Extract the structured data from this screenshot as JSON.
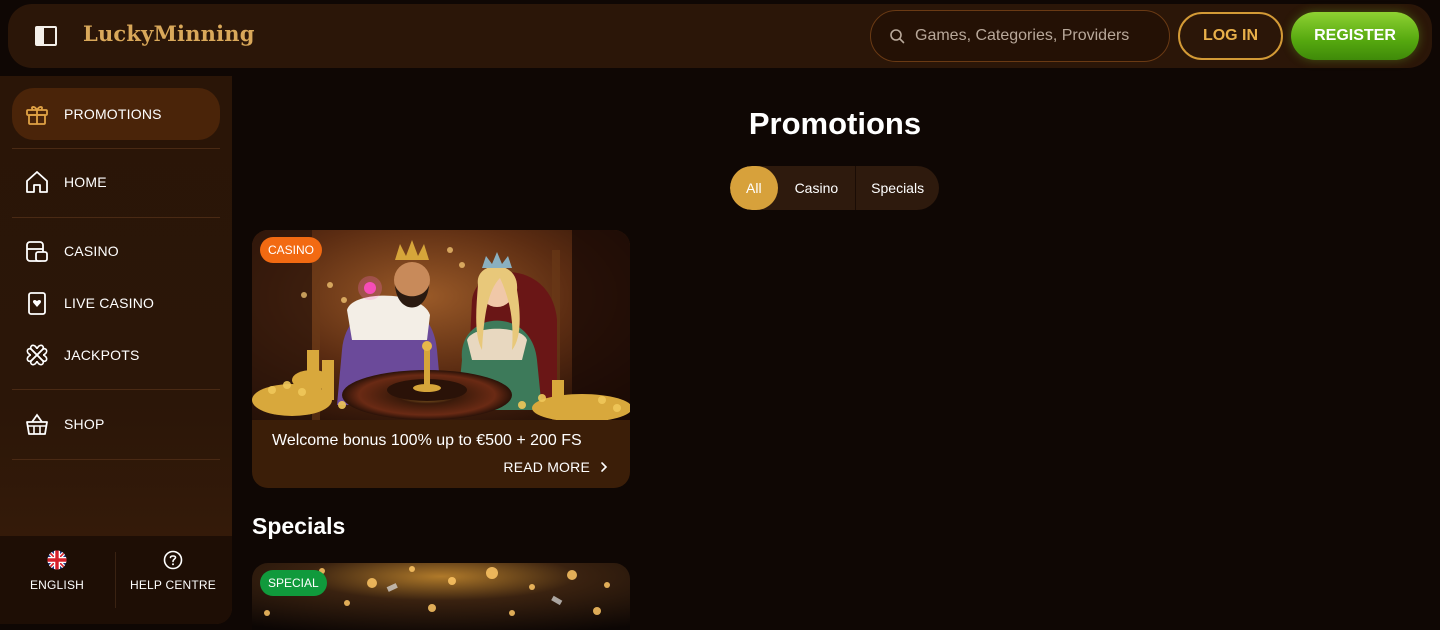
{
  "header": {
    "logo": "LuckyMinning",
    "search_placeholder": "Games, Categories, Providers",
    "login_label": "LOG IN",
    "register_label": "REGISTER"
  },
  "sidebar": {
    "items": [
      {
        "label": "PROMOTIONS",
        "icon": "gift-icon",
        "active": true
      },
      {
        "label": "HOME",
        "icon": "home-icon"
      },
      {
        "label": "CASINO",
        "icon": "slot-machine-icon"
      },
      {
        "label": "LIVE CASINO",
        "icon": "playing-card-icon"
      },
      {
        "label": "JACKPOTS",
        "icon": "clover-icon"
      },
      {
        "label": "SHOP",
        "icon": "basket-icon"
      }
    ],
    "language_label": "ENGLISH",
    "help_label": "HELP CENTRE"
  },
  "main": {
    "title": "Promotions",
    "filters": [
      {
        "label": "All",
        "active": true
      },
      {
        "label": "Casino"
      },
      {
        "label": "Specials"
      }
    ],
    "promo": {
      "badge": "CASINO",
      "title": "Welcome bonus 100% up to €500 + 200 FS",
      "read_more": "READ MORE"
    },
    "specials_title": "Specials",
    "special_badge": "SPECIAL"
  },
  "colors": {
    "background": "#0f0704",
    "panel": "#2b1608",
    "accent_gold": "#d7a13b",
    "register_green": "#6bbf1e",
    "badge_casino": "#f26a12",
    "badge_special": "#109a3c"
  }
}
